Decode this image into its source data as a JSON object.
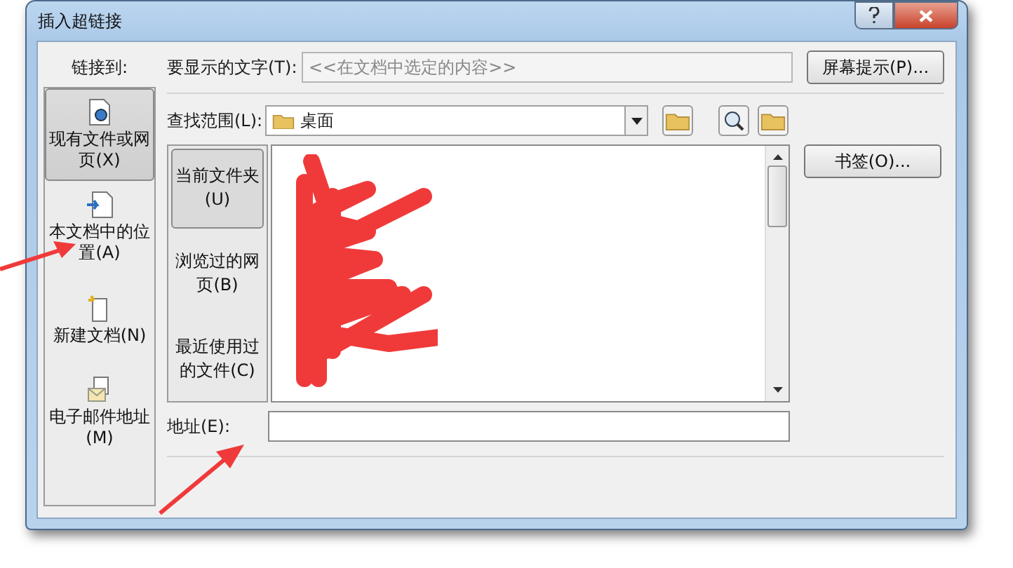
{
  "window": {
    "title": "插入超链接"
  },
  "link_to": {
    "label": "链接到:",
    "items": [
      {
        "kind": "file",
        "label": "现有文件或网页(X)",
        "selected": true
      },
      {
        "kind": "place",
        "label": "本文档中的位置(A)",
        "selected": false
      },
      {
        "kind": "new",
        "label": "新建文档(N)",
        "selected": false
      },
      {
        "kind": "mail",
        "label": "电子邮件地址(M)",
        "selected": false
      }
    ]
  },
  "display_text": {
    "label": "要显示的文字(T):",
    "value": "<<在文档中选定的内容>>"
  },
  "screen_tip_button": "屏幕提示(P)...",
  "look_in": {
    "label": "查找范围(L):",
    "value": "桌面"
  },
  "sources": [
    {
      "label": "当前文件夹(U)",
      "selected": true
    },
    {
      "label": "浏览过的网页(B)",
      "selected": false
    },
    {
      "label": "最近使用过的文件(C)",
      "selected": false
    }
  ],
  "bookmark_button": "书签(O)...",
  "address": {
    "label": "地址(E):"
  }
}
